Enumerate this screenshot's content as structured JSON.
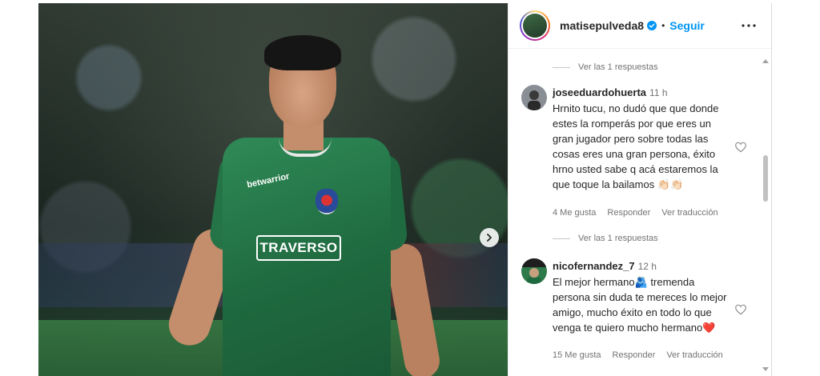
{
  "post": {
    "username": "matisepulveda8",
    "dot": "•",
    "follow_label": "Seguir",
    "photo_sponsor": "TRAVERSO",
    "photo_logo": "betwarrior"
  },
  "comments": [
    {
      "replies_label": "Ver las 1 respuestas",
      "username": "joseeduardohuerta",
      "time": "11 h",
      "text": "Hrnito tucu, no dudó que que donde estes la romperás por que eres un gran jugador pero sobre todas las cosas eres una gran persona, éxito hrno usted sabe q acá estaremos la que toque la bailamos 👏🏻👏🏻",
      "likes": "4 Me gusta",
      "reply": "Responder",
      "translate": "Ver traducción"
    },
    {
      "replies_label": "Ver las 1 respuestas",
      "username": "nicofernandez_7",
      "time": "12 h",
      "text": "El mejor hermano🫂 tremenda persona sin duda te mereces lo mejor amigo, mucho éxito en todo lo que venga te quiero mucho hermano❤️",
      "likes": "15 Me gusta",
      "reply": "Responder",
      "translate": "Ver traducción"
    }
  ],
  "icons": {
    "verified": "verified-badge-icon",
    "more": "more-options-icon",
    "next": "chevron-right-icon",
    "heart": "heart-outline-icon"
  },
  "colors": {
    "follow": "#0095f6",
    "verified": "#0095f6",
    "heart_emoji": "#e0245e"
  }
}
